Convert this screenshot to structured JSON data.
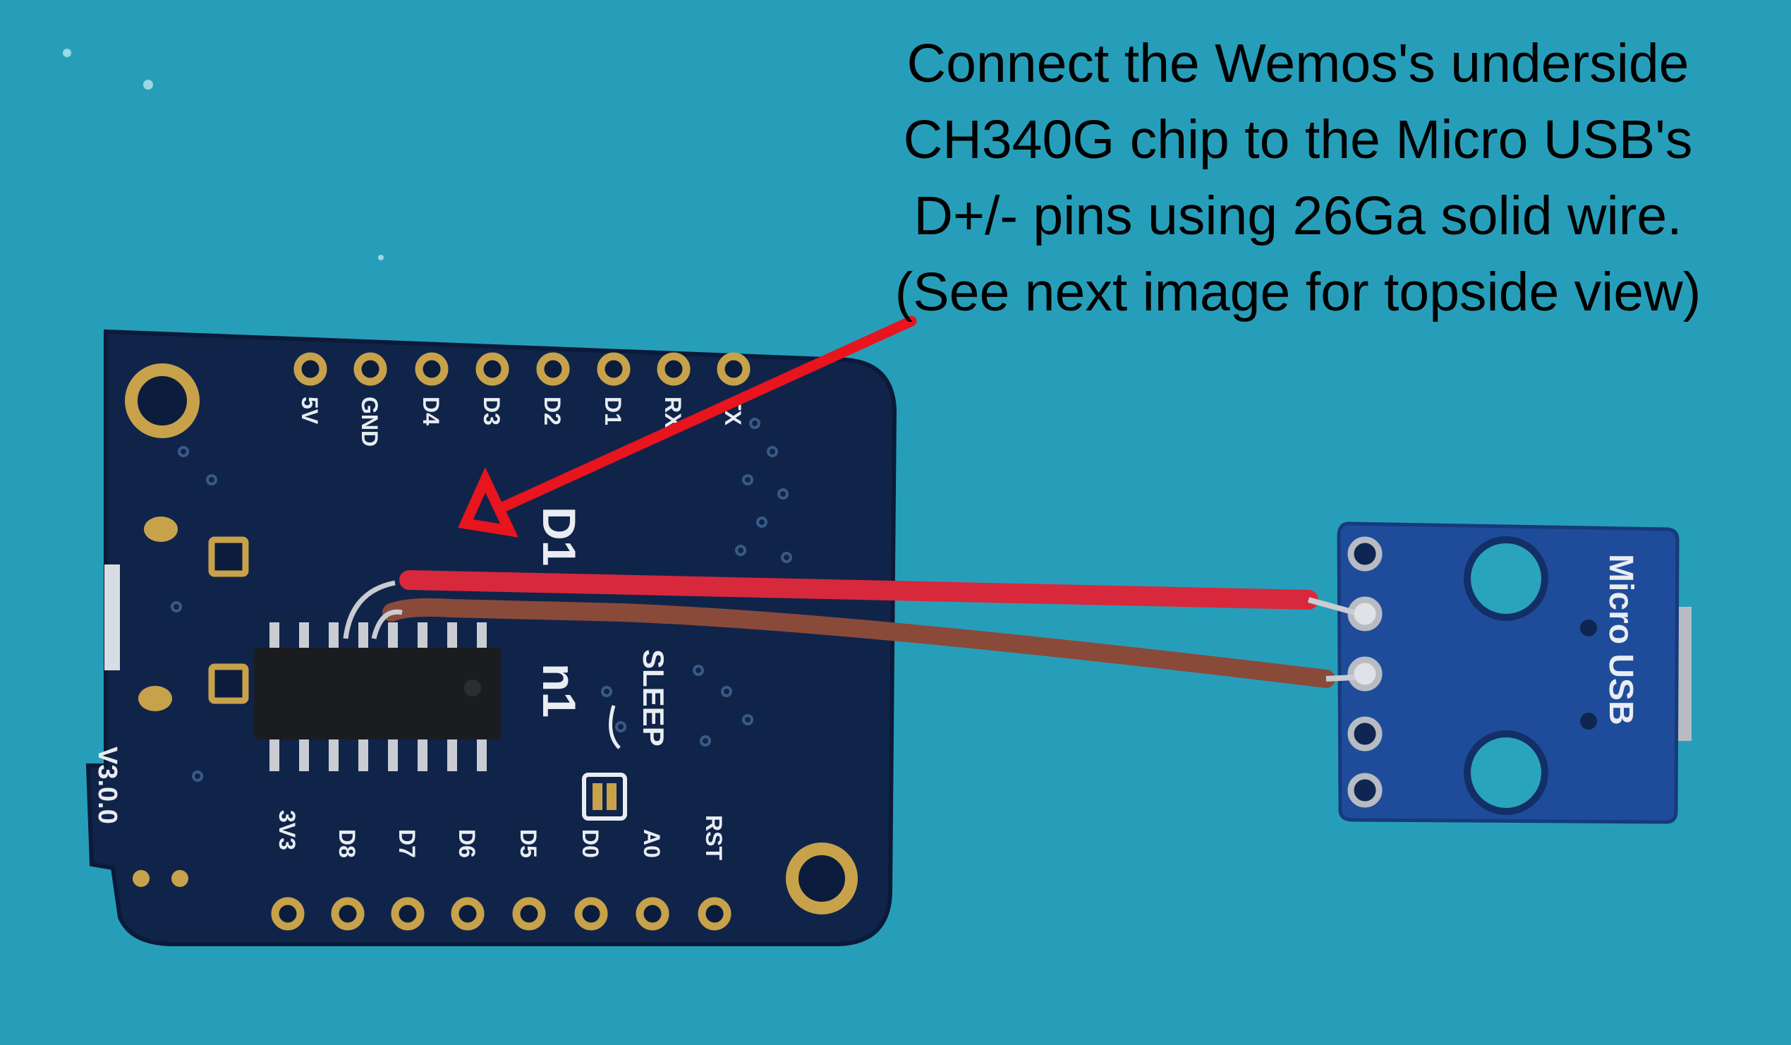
{
  "caption": {
    "lines": [
      "Connect the Wemos's underside",
      "CH340G chip to the Micro USB's",
      "D+/- pins using 26Ga solid wire.",
      "(See next image for topside view)"
    ]
  },
  "board": {
    "top_pins": [
      "5V",
      "GND",
      "D4",
      "D3",
      "D2",
      "D1",
      "RX",
      "TX"
    ],
    "bottom_pins": [
      "3V3",
      "D8",
      "D7",
      "D6",
      "D5",
      "D0",
      "A0",
      "RST"
    ],
    "version": "V3.0.0",
    "sleep_label": "SLEEP",
    "silk_fragment_1": "D1",
    "silk_fragment_2": "n1"
  },
  "usb_breakout": {
    "label": "Micro USB"
  },
  "colors": {
    "mat": "#2aa3bd",
    "pcb": "#10244a",
    "breakout": "#1f4c9a",
    "arrow": "#e8141e",
    "red_wire": "#d8283c",
    "brown_wire": "#8a4a3a",
    "gold": "#c8a24a"
  },
  "icons": [
    "arrow-icon"
  ]
}
